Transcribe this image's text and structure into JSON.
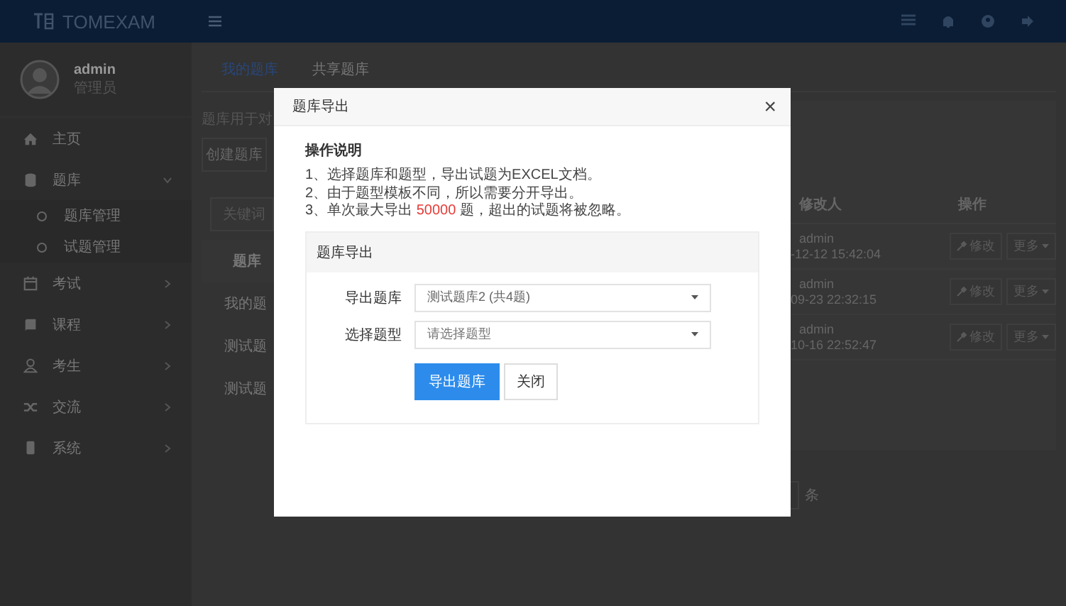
{
  "navbar": {
    "brand": "TOMEXAM"
  },
  "user": {
    "name": "admin",
    "role": "管理员"
  },
  "menu": [
    {
      "label": "主页"
    },
    {
      "label": "题库",
      "expanded": true,
      "children": [
        {
          "label": "题库管理"
        },
        {
          "label": "试题管理"
        }
      ]
    },
    {
      "label": "考试",
      "expanded": false
    },
    {
      "label": "课程",
      "expanded": false
    },
    {
      "label": "考生",
      "expanded": false
    },
    {
      "label": "交流",
      "expanded": false
    },
    {
      "label": "系统",
      "expanded": false
    }
  ],
  "tabs": [
    {
      "label": "我的题库",
      "selected": true
    },
    {
      "label": "共享题库",
      "selected": false
    }
  ],
  "background_left": {
    "hint": "题库用于对",
    "create_button": "创建题库",
    "keyword_placeholder": "关键词",
    "column_1": "题库",
    "rows": [
      "我的题",
      "测试题",
      "测试题"
    ]
  },
  "background_right": {
    "columns": [
      "修改人",
      "操作"
    ],
    "rows": [
      {
        "user": "admin",
        "time": "-12-12 15:42:04",
        "edit": "修改",
        "more": "更多"
      },
      {
        "user": "admin",
        "time": "09-23 22:32:15",
        "edit": "修改",
        "more": "更多"
      },
      {
        "user": "admin",
        "time": "10-16 22:52:47",
        "edit": "修改",
        "more": "更多"
      }
    ],
    "page_size_unit": "条"
  },
  "dialog": {
    "title": "题库导出",
    "close": "×",
    "instructions_title": "操作说明",
    "instructions": [
      [
        {
          "text": "1、选择题库和题型，导出试题为EXCEL文档。"
        }
      ],
      [
        {
          "text": "2、由于题型模板不同，所以需要分开导出。"
        }
      ],
      [
        {
          "text": "3、单次最大导出 "
        },
        {
          "text": "50000",
          "highlight": true
        },
        {
          "text": " 题，超出的试题将被忽略。"
        }
      ]
    ],
    "panel_title": "题库导出",
    "fields": [
      {
        "label": "导出题库",
        "value": "测试题库2 (共4题)"
      },
      {
        "label": "选择题型",
        "placeholder": "请选择题型"
      }
    ],
    "buttons": [
      {
        "label": "导出题库",
        "primary": true
      },
      {
        "label": "关闭",
        "primary": false
      }
    ]
  }
}
